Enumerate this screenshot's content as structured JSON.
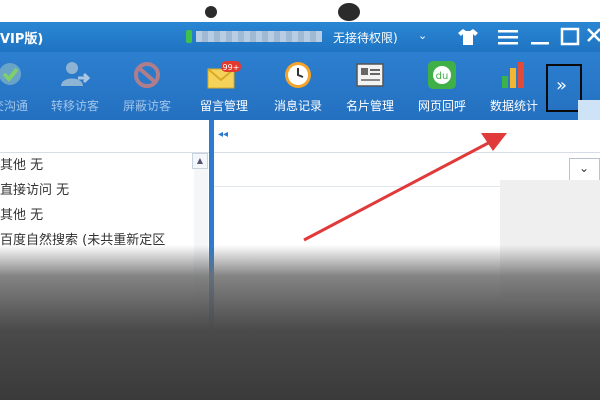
{
  "titlebar": {
    "app_title": "VIP版)",
    "status_text": "无接待权限)",
    "status_caret": "⌄"
  },
  "toolbar": {
    "items": [
      {
        "label": "交沟通",
        "icon": "chat-check-icon",
        "disabled": true
      },
      {
        "label": "转移访客",
        "icon": "transfer-visitor-icon",
        "disabled": true
      },
      {
        "label": "屏蔽访客",
        "icon": "block-icon",
        "disabled": true
      },
      {
        "label": "留言管理",
        "icon": "envelope-icon",
        "disabled": false,
        "badge": "99+"
      },
      {
        "label": "消息记录",
        "icon": "clock-icon",
        "disabled": false
      },
      {
        "label": "名片管理",
        "icon": "business-card-icon",
        "disabled": false
      },
      {
        "label": "网页回呼",
        "icon": "callback-icon",
        "disabled": false,
        "icon_text": "du"
      },
      {
        "label": "数据统计",
        "icon": "bar-chart-icon",
        "disabled": false
      }
    ],
    "more_label": "»"
  },
  "left_list": {
    "rows": [
      "其他 无",
      "直接访问 无",
      "其他 无",
      "百度自然搜索 (未共重新定区"
    ]
  },
  "right_panel": {
    "collapse_label": "◂◂",
    "dropdown_label": "⌄"
  },
  "colors": {
    "titlebar": "#2a86d3",
    "toolbar": "#2d7fd0",
    "arrow": "#e03a3a",
    "highlight_box": "#0a0a0a"
  }
}
